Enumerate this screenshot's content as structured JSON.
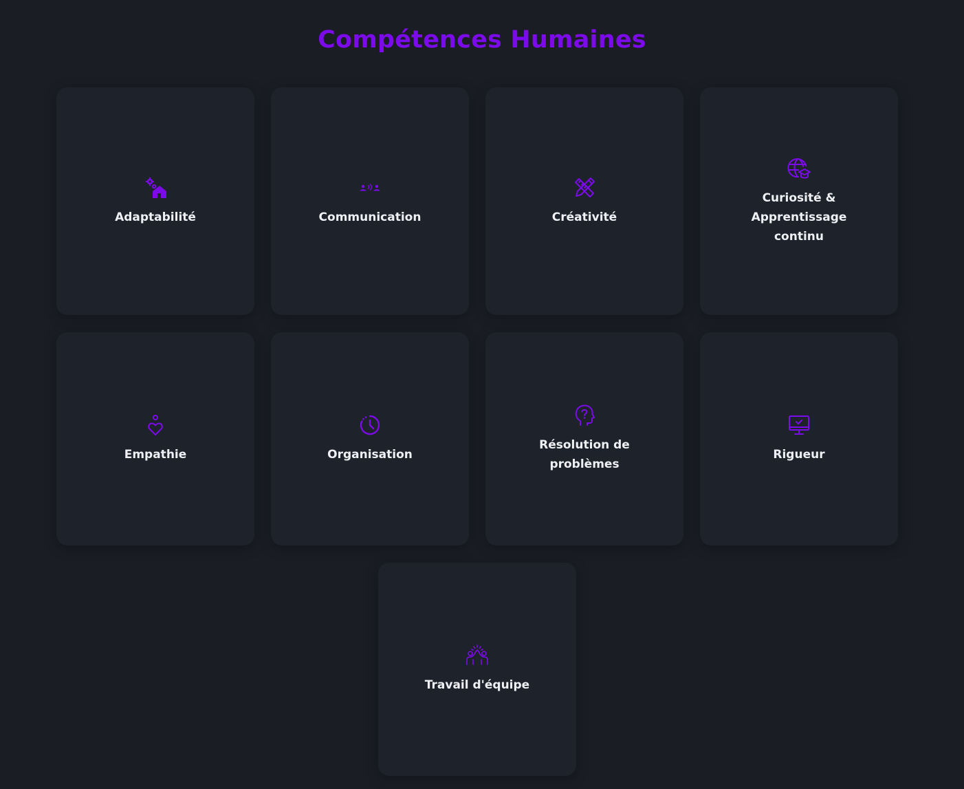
{
  "section": {
    "title": "Compétences Humaines"
  },
  "accent_color": "#7c0bea",
  "skills": [
    {
      "label": "Adaptabilité",
      "icon": "gears-house-icon"
    },
    {
      "label": "Communication",
      "icon": "people-talking-icon"
    },
    {
      "label": "Créativité",
      "icon": "pencil-ruler-icon"
    },
    {
      "label": "Curiosité & Apprentissage continu",
      "icon": "globe-graduation-cap-icon"
    },
    {
      "label": "Empathie",
      "icon": "person-heart-icon"
    },
    {
      "label": "Organisation",
      "icon": "clock-icon"
    },
    {
      "label": "Résolution de problèmes",
      "icon": "head-question-icon"
    },
    {
      "label": "Rigueur",
      "icon": "monitor-check-icon"
    },
    {
      "label": "Travail d'équipe",
      "icon": "teamwork-high-five-icon"
    }
  ]
}
